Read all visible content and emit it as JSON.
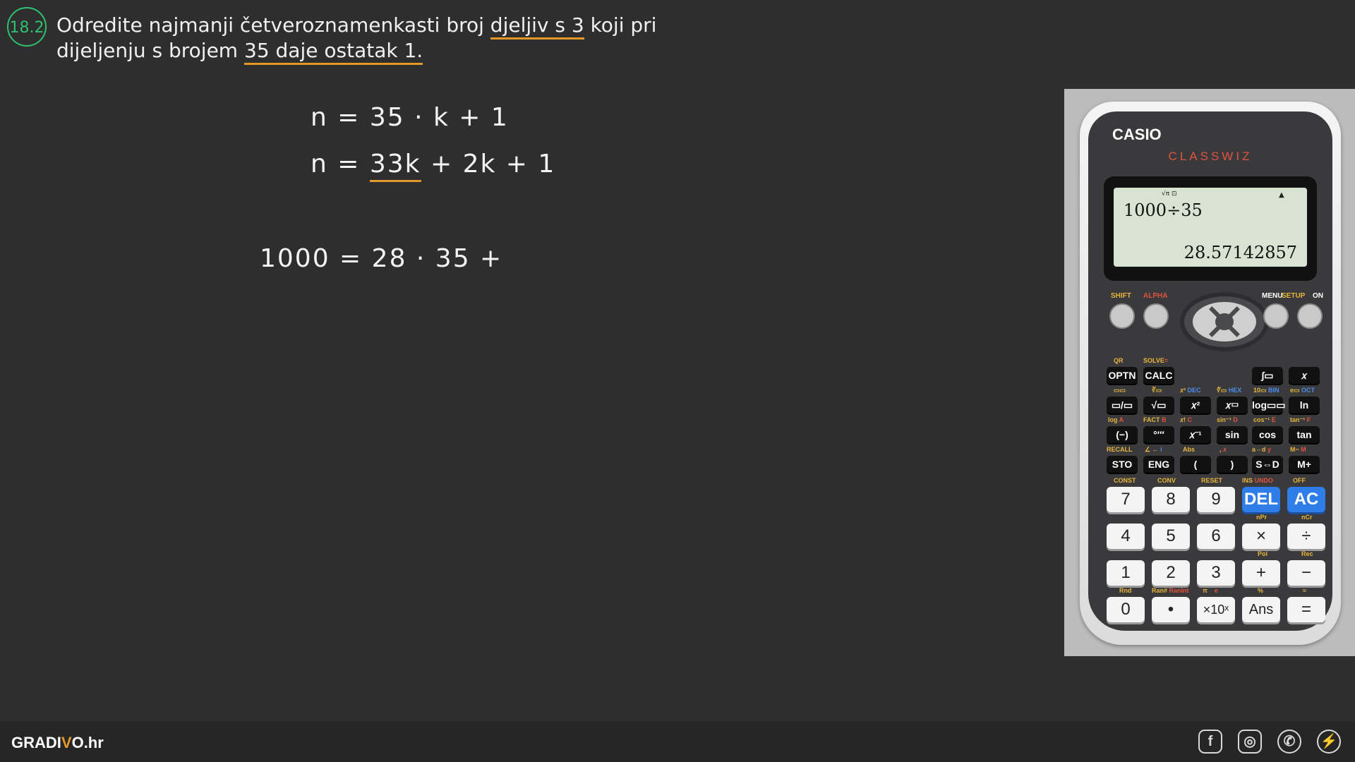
{
  "problem": {
    "number": "18.2",
    "text_part1": "Odredite najmanji četveroznamenkasti broj ",
    "highlight1": "djeljiv s 3",
    "text_part2": " koji pri dijeljenju s brojem ",
    "highlight2": "35 daje ostatak 1."
  },
  "work": {
    "line1": "n = 35 · k + 1",
    "line2_prefix": "n = ",
    "line2_under": "33k",
    "line2_rest": " + 2k + 1",
    "line3": "1000 = 28 · 35 +"
  },
  "calculator": {
    "brand": "CASIO",
    "model": "CLASSWIZ",
    "indicator": "√π ⊡",
    "arrow": "▲",
    "expression": "1000÷35",
    "result": "28.57142857",
    "labels": {
      "shift": "SHIFT",
      "alpha": "ALPHA",
      "menu": "MENU",
      "setup": "SETUP",
      "on": "ON"
    },
    "function_rows": [
      [
        "OPTN",
        "CALC",
        "∫▭",
        "𝑥"
      ],
      [
        "▭/▭",
        "√▭",
        "𝑥²",
        "𝑥▭",
        "log▭▭",
        "ln"
      ],
      [
        "(−)",
        "°′″",
        "𝑥⁻¹",
        "sin",
        "cos",
        "tan"
      ],
      [
        "STO",
        "ENG",
        "(",
        ")",
        "S⇔D",
        "M+"
      ]
    ],
    "num_rows": [
      [
        "7",
        "8",
        "9",
        "DEL",
        "AC"
      ],
      [
        "4",
        "5",
        "6",
        "×",
        "÷"
      ],
      [
        "1",
        "2",
        "3",
        "+",
        "−"
      ],
      [
        "0",
        "•",
        "×10ˣ",
        "Ans",
        "="
      ]
    ],
    "num_labels": {
      "const": "CONST",
      "conv": "CONV",
      "reset": "RESET",
      "ins": "INS",
      "undo": "UNDO",
      "off": "OFF",
      "npr": "nPr",
      "ncr": "nCr",
      "pol": "Pol",
      "rec": "Rec",
      "rnd": "Rnd",
      "ran": "Ran#",
      "ranint": "RanInt",
      "pi": "π",
      "e": "e",
      "pct": "%",
      "approx": "≈"
    }
  },
  "footer": {
    "logo_prefix": "GRADI",
    "logo_v": "V",
    "logo_suffix": "O.hr",
    "social": [
      "f",
      "◎",
      "✆",
      "⚡"
    ]
  }
}
